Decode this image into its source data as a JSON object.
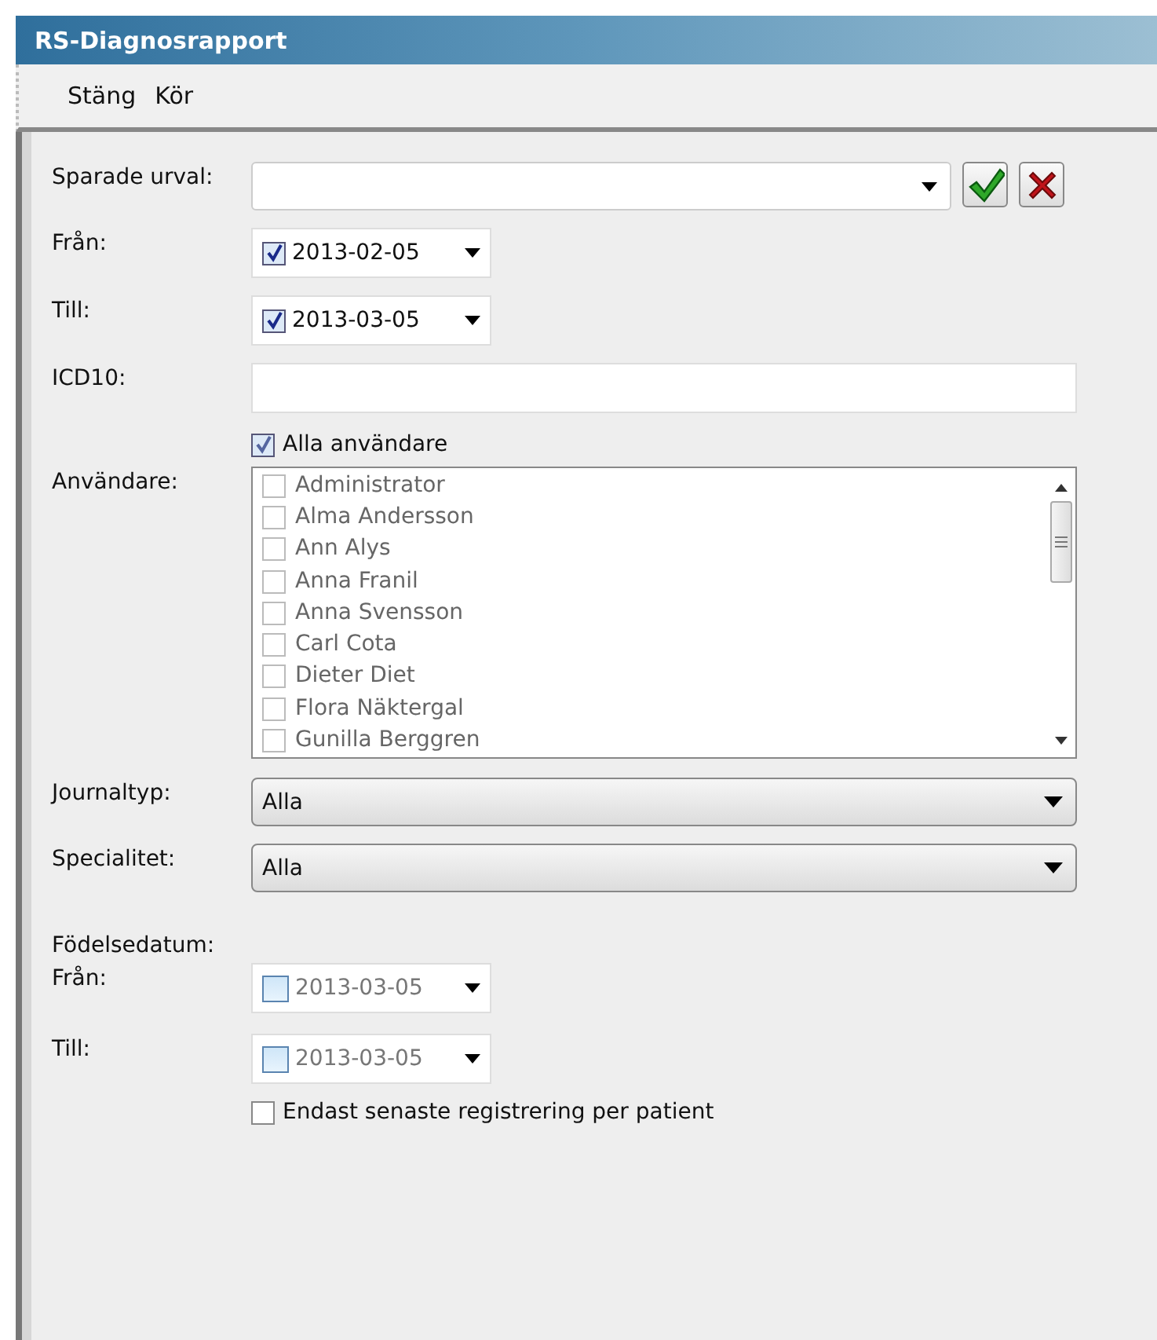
{
  "window": {
    "title": "RS-Diagnosrapport"
  },
  "menu": [
    {
      "label": "Stäng"
    },
    {
      "label": "Kör"
    }
  ],
  "saved_selection": {
    "label": "Sparade urval:"
  },
  "from": {
    "label": "Från:",
    "checked": true,
    "value": "2013-02-05"
  },
  "to": {
    "label": "Till:",
    "checked": true,
    "value": "2013-03-05"
  },
  "icd10": {
    "label": "ICD10:"
  },
  "all_users": {
    "label": "Alla användare",
    "checked": true
  },
  "users": {
    "label": "Användare:",
    "disabled": true,
    "items": [
      {
        "name": "Administrator",
        "checked": false
      },
      {
        "name": "Alma Andersson",
        "checked": false
      },
      {
        "name": "Ann Alys",
        "checked": false
      },
      {
        "name": "Anna Franil",
        "checked": false
      },
      {
        "name": "Anna Svensson",
        "checked": false
      },
      {
        "name": "Carl Cota",
        "checked": false
      },
      {
        "name": "Dieter Diet",
        "checked": false
      },
      {
        "name": "Flora Näktergal",
        "checked": false
      },
      {
        "name": "Gunilla Berggren",
        "checked": false
      }
    ]
  },
  "journal_type": {
    "label": "Journaltyp:",
    "value": "Alla"
  },
  "specialty": {
    "label": "Specialitet:",
    "value": "Alla"
  },
  "birth_date": {
    "label": "Födelsedatum:",
    "from": {
      "label": "Från:",
      "checked": false,
      "value": "2013-03-05"
    },
    "to": {
      "label": "Till:",
      "checked": false,
      "value": "2013-03-05"
    }
  },
  "latest_only": {
    "label": "Endast senaste registrering per patient",
    "checked": false
  }
}
